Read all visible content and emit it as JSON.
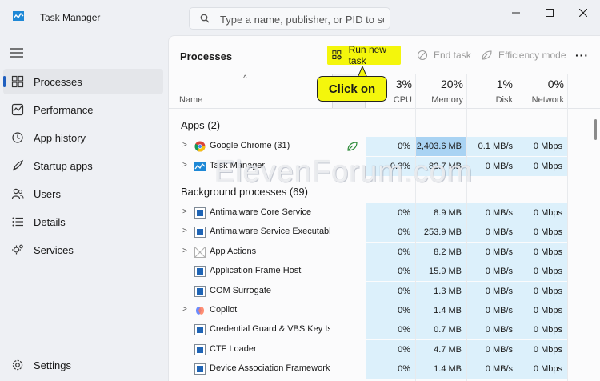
{
  "app": {
    "title": "Task Manager"
  },
  "search": {
    "placeholder": "Type a name, publisher, or PID to se..."
  },
  "sidebar": {
    "items": [
      {
        "label": "Processes",
        "icon": "processes-icon",
        "active": true
      },
      {
        "label": "Performance",
        "icon": "performance-icon"
      },
      {
        "label": "App history",
        "icon": "history-icon"
      },
      {
        "label": "Startup apps",
        "icon": "startup-icon"
      },
      {
        "label": "Users",
        "icon": "users-icon"
      },
      {
        "label": "Details",
        "icon": "details-icon"
      },
      {
        "label": "Services",
        "icon": "services-icon"
      }
    ],
    "settings": "Settings"
  },
  "toolbar": {
    "title": "Processes",
    "run_new_task": "Run new task",
    "end_task": "End task",
    "efficiency_mode": "Efficiency mode",
    "more": "···"
  },
  "callout": {
    "text": "Click on"
  },
  "columns": {
    "name": "Name",
    "cpu": {
      "pct": "3%",
      "label": "CPU"
    },
    "memory": {
      "pct": "20%",
      "label": "Memory"
    },
    "disk": {
      "pct": "1%",
      "label": "Disk"
    },
    "network": {
      "pct": "0%",
      "label": "Network"
    }
  },
  "sections": {
    "apps": "Apps (2)",
    "background": "Background processes (69)"
  },
  "apps": [
    {
      "name": "Google Chrome (31)",
      "cpu": "0%",
      "memory": "2,403.6 MB",
      "disk": "0.1 MB/s",
      "network": "0 Mbps",
      "expand": true,
      "icon": "chrome-icon",
      "efficiency": true
    },
    {
      "name": "Task Manager",
      "cpu": "0.3%",
      "memory": "82.7 MB",
      "disk": "0 MB/s",
      "network": "0 Mbps",
      "expand": true,
      "icon": "taskmanager-icon"
    }
  ],
  "background": [
    {
      "name": "Antimalware Core Service",
      "cpu": "0%",
      "memory": "8.9 MB",
      "disk": "0 MB/s",
      "network": "0 Mbps",
      "expand": true,
      "icon": "service-icon"
    },
    {
      "name": "Antimalware Service Executable",
      "cpu": "0%",
      "memory": "253.9 MB",
      "disk": "0 MB/s",
      "network": "0 Mbps",
      "expand": true,
      "icon": "service-icon"
    },
    {
      "name": "App Actions",
      "cpu": "0%",
      "memory": "8.2 MB",
      "disk": "0 MB/s",
      "network": "0 Mbps",
      "expand": true,
      "icon": "app-actions-icon"
    },
    {
      "name": "Application Frame Host",
      "cpu": "0%",
      "memory": "15.9 MB",
      "disk": "0 MB/s",
      "network": "0 Mbps",
      "expand": false,
      "icon": "service-icon"
    },
    {
      "name": "COM Surrogate",
      "cpu": "0%",
      "memory": "1.3 MB",
      "disk": "0 MB/s",
      "network": "0 Mbps",
      "expand": false,
      "icon": "service-icon"
    },
    {
      "name": "Copilot",
      "cpu": "0%",
      "memory": "1.4 MB",
      "disk": "0 MB/s",
      "network": "0 Mbps",
      "expand": true,
      "icon": "copilot-icon"
    },
    {
      "name": "Credential Guard & VBS Key Is...",
      "cpu": "0%",
      "memory": "0.7 MB",
      "disk": "0 MB/s",
      "network": "0 Mbps",
      "expand": false,
      "icon": "service-icon"
    },
    {
      "name": "CTF Loader",
      "cpu": "0%",
      "memory": "4.7 MB",
      "disk": "0 MB/s",
      "network": "0 Mbps",
      "expand": false,
      "icon": "service-icon"
    },
    {
      "name": "Device Association Framework...",
      "cpu": "0%",
      "memory": "1.4 MB",
      "disk": "0 MB/s",
      "network": "0 Mbps",
      "expand": false,
      "icon": "service-icon"
    }
  ],
  "watermark": "ElevenForum.com",
  "colors": {
    "highlight": "#f4f60c",
    "cell": "#dcf0fb",
    "cell_hot": "#a9d3f3",
    "accent": "#1f5fbf"
  }
}
